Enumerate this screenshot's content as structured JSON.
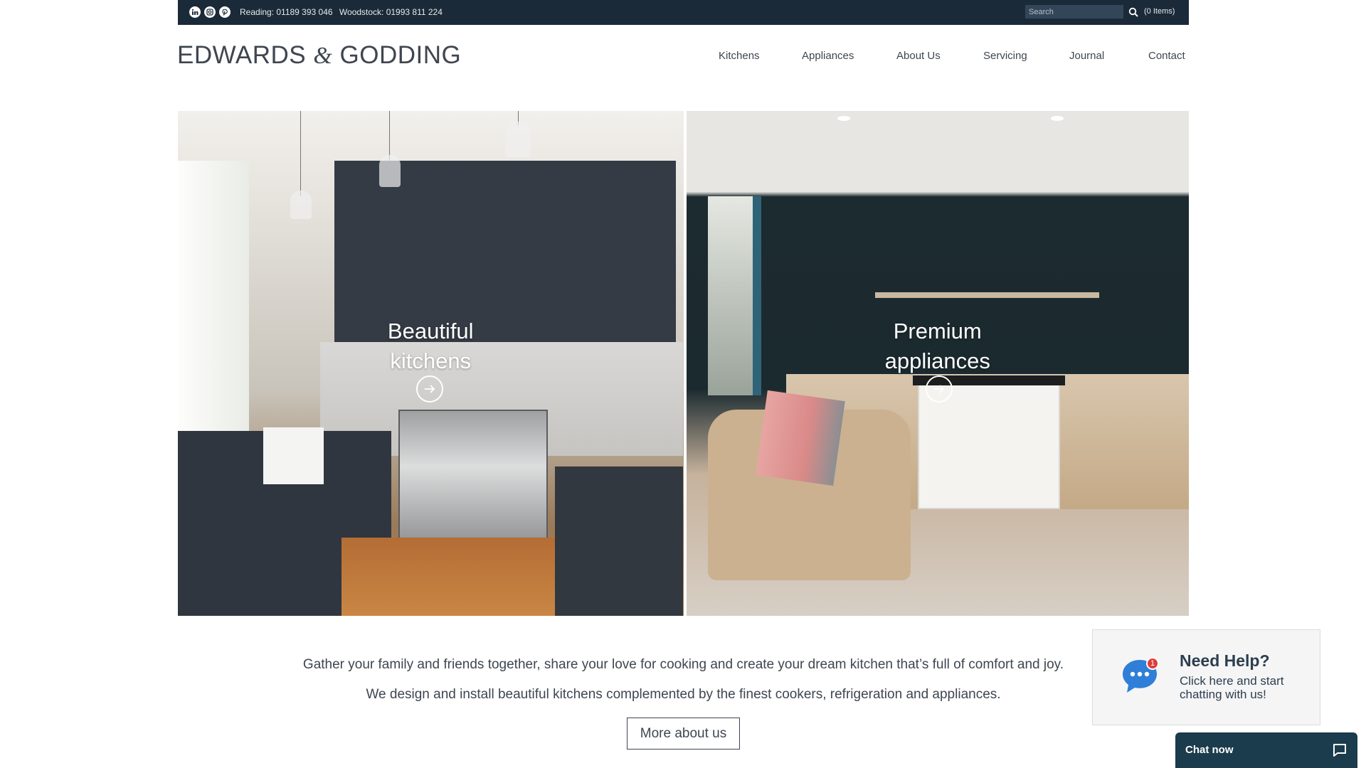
{
  "topbar": {
    "social": [
      "linkedin-icon",
      "instagram-icon",
      "pinterest-icon"
    ],
    "phone_reading": "Reading: 01189 393 046",
    "phone_woodstock": "Woodstock: 01993 811 224",
    "search_placeholder": "Search",
    "cart": "(0 Items)"
  },
  "header": {
    "logo_left": "EDWARDS",
    "logo_amp": "&",
    "logo_right": "GODDING",
    "nav": [
      "Kitchens",
      "Appliances",
      "About Us",
      "Servicing",
      "Journal",
      "Contact"
    ]
  },
  "hero": {
    "left_title_1": "Beautiful",
    "left_title_2": "kitchens",
    "right_title_1": "Premium",
    "right_title_2": "appliances"
  },
  "intro": {
    "line1": "Gather your family and friends together, share your love for cooking and create your dream kitchen that’s full of comfort and joy.",
    "line2": "We design and install beautiful kitchens complemented by the finest cookers, refrigeration and appliances.",
    "button": "More about us"
  },
  "help": {
    "badge": "1",
    "title": "Need Help?",
    "text": "Click here and start chatting with us!"
  },
  "chat": {
    "label": "Chat now"
  },
  "colors": {
    "topbar": "#1b2a38",
    "chat": "#1b3c4c",
    "bubble": "#2f7fd8"
  }
}
